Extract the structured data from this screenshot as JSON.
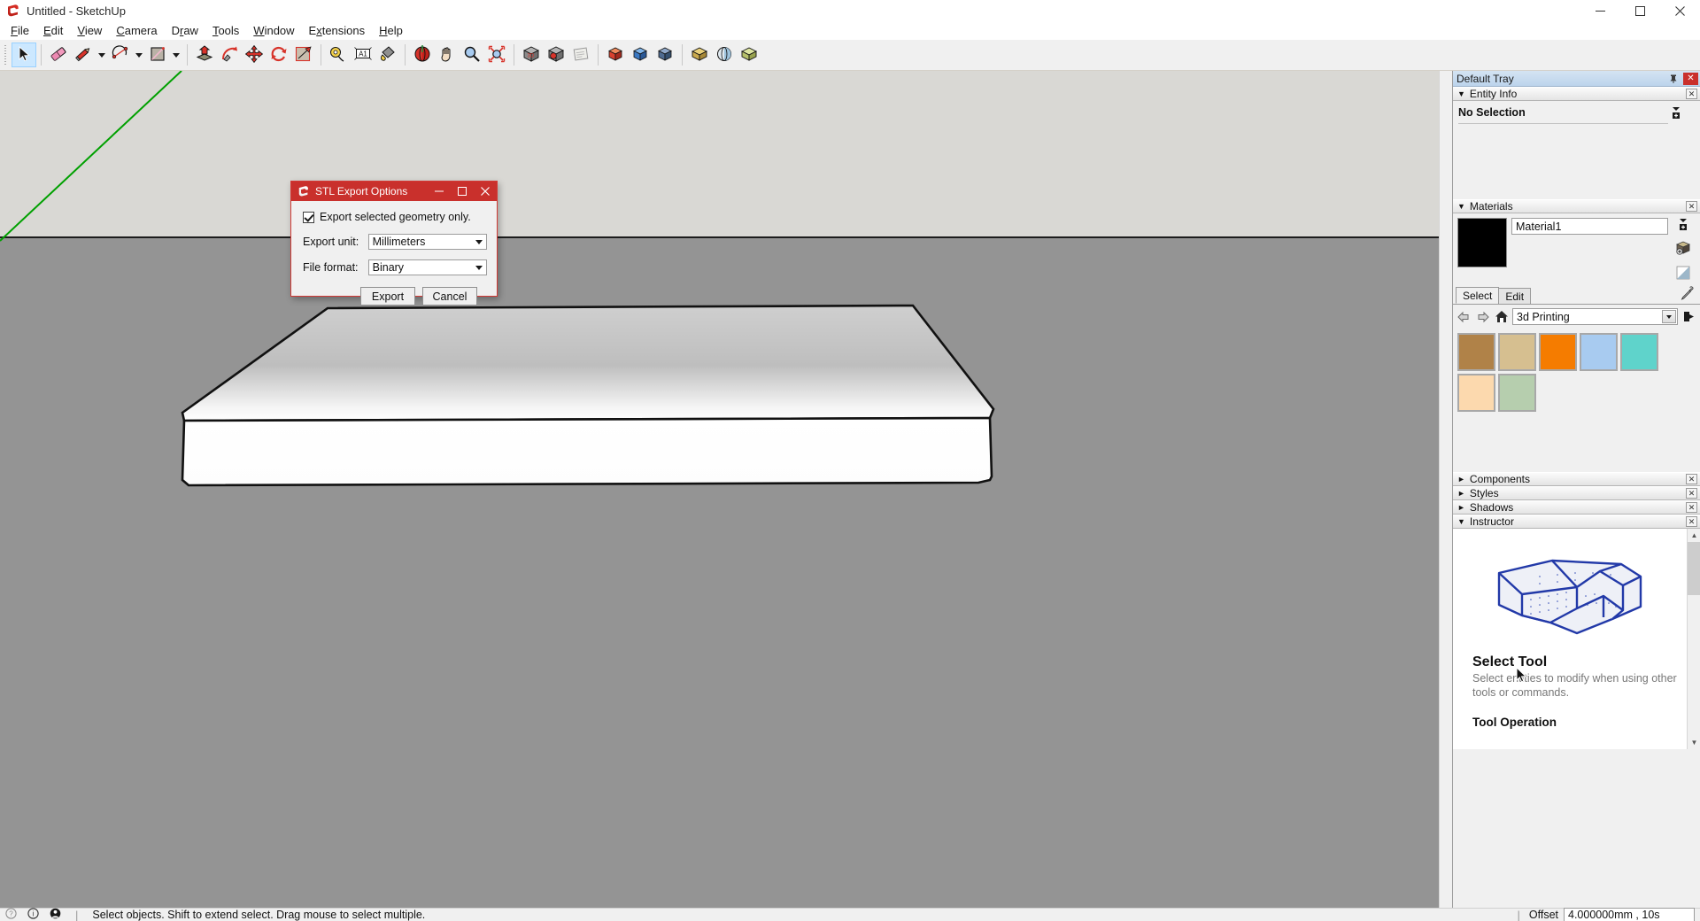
{
  "window": {
    "title": "Untitled - SketchUp",
    "logo_icon": "sketchup-logo-icon",
    "minimize_label": "Minimize",
    "maximize_label": "Maximize",
    "close_label": "Close"
  },
  "menubar": {
    "items": [
      {
        "label": "File",
        "accel": "F"
      },
      {
        "label": "Edit",
        "accel": "E"
      },
      {
        "label": "View",
        "accel": "V"
      },
      {
        "label": "Camera",
        "accel": "C"
      },
      {
        "label": "Draw",
        "accel": "r"
      },
      {
        "label": "Tools",
        "accel": "T"
      },
      {
        "label": "Window",
        "accel": "W"
      },
      {
        "label": "Extensions",
        "accel": "x"
      },
      {
        "label": "Help",
        "accel": "H"
      }
    ]
  },
  "toolbar": {
    "groups": [
      {
        "buttons": [
          {
            "name": "select-tool",
            "icon": "arrow-cursor-icon",
            "active": true
          }
        ]
      },
      {
        "buttons": [
          {
            "name": "eraser-tool",
            "icon": "eraser-icon",
            "active": false
          },
          {
            "name": "line-tool",
            "icon": "pencil-icon",
            "active": false,
            "dropdown": true
          },
          {
            "name": "arc-tool",
            "icon": "arc-icon",
            "active": false,
            "dropdown": true
          },
          {
            "name": "rectangle-tool",
            "icon": "rectangle-icon",
            "active": false,
            "dropdown": true
          }
        ]
      },
      {
        "buttons": [
          {
            "name": "pushpull-tool",
            "icon": "pushpull-icon",
            "active": false
          },
          {
            "name": "followme-tool",
            "icon": "followme-icon",
            "active": false
          },
          {
            "name": "move-tool",
            "icon": "move-icon",
            "active": false
          },
          {
            "name": "rotate-tool",
            "icon": "rotate-icon",
            "active": false
          },
          {
            "name": "offset-tool",
            "icon": "offset-icon",
            "active": false
          }
        ]
      },
      {
        "buttons": [
          {
            "name": "tape-measure-tool",
            "icon": "tape-measure-icon",
            "active": false
          },
          {
            "name": "text-tool",
            "icon": "text-a1-icon",
            "active": false
          },
          {
            "name": "paint-bucket-tool",
            "icon": "paint-bucket-icon",
            "active": false
          }
        ]
      },
      {
        "buttons": [
          {
            "name": "orbit-tool",
            "icon": "orbit-icon",
            "active": false
          },
          {
            "name": "pan-tool",
            "icon": "hand-pan-icon",
            "active": false
          },
          {
            "name": "zoom-tool",
            "icon": "magnifier-zoom-icon",
            "active": false
          },
          {
            "name": "zoom-extents-tool",
            "icon": "zoom-extents-icon",
            "active": false
          }
        ]
      },
      {
        "buttons": [
          {
            "name": "3d-warehouse-button",
            "icon": "warehouse-box-icon",
            "active": false
          },
          {
            "name": "share-model-button",
            "icon": "share-model-icon",
            "active": false
          },
          {
            "name": "extension-warehouse-button",
            "icon": "extension-warehouse-icon",
            "active": false
          }
        ]
      },
      {
        "buttons": [
          {
            "name": "solid-tools-union",
            "icon": "solid-union-icon",
            "active": false
          },
          {
            "name": "solid-tools-subtract",
            "icon": "solid-subtract-icon",
            "active": false
          },
          {
            "name": "solid-tools-trim",
            "icon": "solid-trim-icon",
            "active": false
          }
        ]
      },
      {
        "buttons": [
          {
            "name": "sandbox-from-contours",
            "icon": "sandbox-contours-icon",
            "active": false
          },
          {
            "name": "sandbox-from-scratch",
            "icon": "sandbox-scratch-icon",
            "active": false
          },
          {
            "name": "sandbox-drape",
            "icon": "sandbox-drape-icon",
            "active": false
          }
        ]
      }
    ]
  },
  "viewport": {
    "name": "model-viewport",
    "sky_color": "#d9d8d4",
    "ground_color": "#949494",
    "green_axis_color": "#00a000",
    "model_top_face_color": "#c3c3c3",
    "model_front_face_color": "#ffffff",
    "edge_color": "#000000"
  },
  "dialog": {
    "title": "STL Export Options",
    "logo_icon": "sketchup-logo-icon",
    "titlebar_color": "#c9302c",
    "minimize_label": "Minimize",
    "maximize_label": "Maximize",
    "close_label": "Close",
    "checkbox": {
      "label": "Export selected geometry only.",
      "checked": true
    },
    "fields": [
      {
        "label": "Export unit:",
        "value": "Millimeters",
        "name": "export-unit-select"
      },
      {
        "label": "File format:",
        "value": "Binary",
        "name": "file-format-select"
      }
    ],
    "buttons": [
      {
        "label": "Export",
        "name": "export-button"
      },
      {
        "label": "Cancel",
        "name": "cancel-button"
      }
    ]
  },
  "tray": {
    "title": "Default Tray",
    "pin_icon": "pin-icon",
    "close_icon": "close-icon",
    "panels": [
      {
        "label": "Entity Info",
        "expanded": true,
        "name": "panel-entity-info"
      },
      {
        "label": "Materials",
        "expanded": true,
        "name": "panel-materials"
      },
      {
        "label": "Components",
        "expanded": false,
        "name": "panel-components"
      },
      {
        "label": "Styles",
        "expanded": false,
        "name": "panel-styles"
      },
      {
        "label": "Shadows",
        "expanded": false,
        "name": "panel-shadows"
      },
      {
        "label": "Instructor",
        "expanded": true,
        "name": "panel-instructor"
      }
    ],
    "entity_info": {
      "status": "No Selection",
      "detail_icon": "expand-details-icon"
    },
    "materials": {
      "current_swatch_color": "#000000",
      "current_name": "Material1",
      "side_icons": [
        "expand-details-icon",
        "create-material-icon",
        "display-secondary-icon"
      ],
      "tabs": [
        {
          "label": "Select",
          "active": true
        },
        {
          "label": "Edit",
          "active": false
        }
      ],
      "eyedropper_icon": "eyedropper-icon",
      "nav": {
        "back_icon": "arrow-back-icon",
        "forward_icon": "arrow-forward-icon",
        "home_icon": "home-icon",
        "library": "3d Printing",
        "details_icon": "details-arrow-icon"
      },
      "swatches": [
        {
          "name": "swatch-brown",
          "color": "#b08248"
        },
        {
          "name": "swatch-tan",
          "color": "#d6bf90"
        },
        {
          "name": "swatch-orange",
          "color": "#f57c00"
        },
        {
          "name": "swatch-light-blue",
          "color": "#a8cbf0"
        },
        {
          "name": "swatch-teal",
          "color": "#5fd3cb"
        },
        {
          "name": "swatch-peach",
          "color": "#fcd9ae"
        },
        {
          "name": "swatch-sage",
          "color": "#b6ceae"
        }
      ]
    },
    "instructor": {
      "image_name": "house-wireframe-illustration",
      "heading": "Select Tool",
      "description": "Select entities to modify when using other tools or commands.",
      "subheading": "Tool Operation"
    }
  },
  "statusbar": {
    "icons": [
      "help-icon",
      "info-icon",
      "account-icon"
    ],
    "message": "Select objects. Shift to extend select. Drag mouse to select multiple.",
    "measurement_label": "Offset",
    "measurement_value": "4.000000mm , 10s"
  }
}
